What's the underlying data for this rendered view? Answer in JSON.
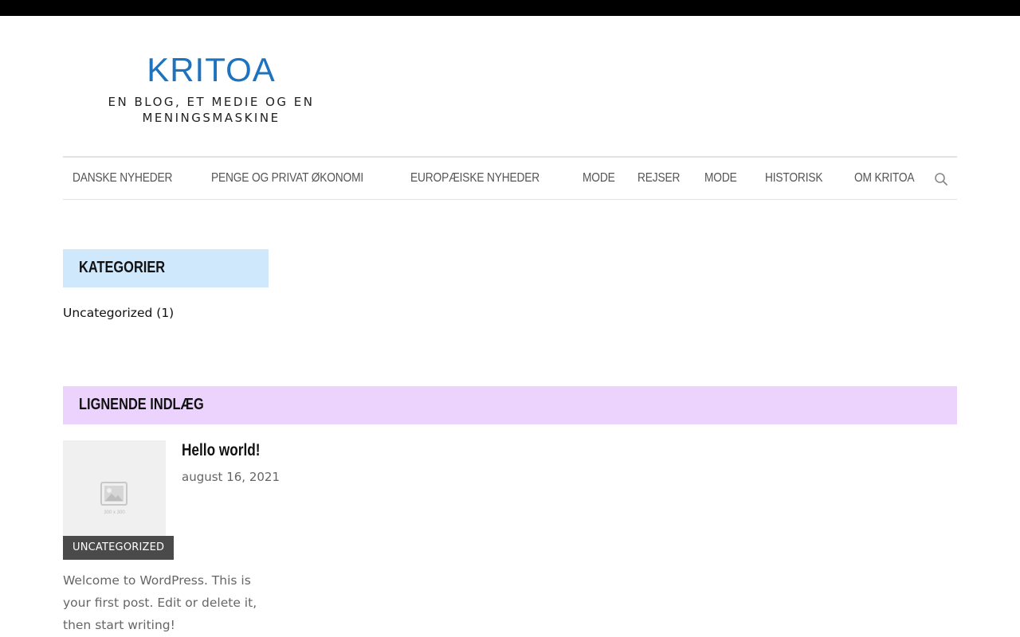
{
  "header": {
    "site_title": "KRITOA",
    "tagline": "EN BLOG, ET MEDIE OG EN MENINGSMASKINE"
  },
  "nav": {
    "items": [
      "DANSKE NYHEDER",
      "PENGE OG PRIVAT ØKONOMI",
      "EUROPÆISKE NYHEDER",
      "MODE",
      "REJSER",
      "MODE",
      "HISTORISK",
      "OM KRITOA"
    ],
    "search_icon": "search-icon"
  },
  "sidebar": {
    "categories_title": "KATEGORIER",
    "category_link": "Uncategorized",
    "category_count": "(1)"
  },
  "related": {
    "title": "LIGNENDE INDLÆG",
    "post": {
      "thumbnail_label": "300 x 300",
      "category": "UNCATEGORIZED",
      "title": "Hello world!",
      "date": "august 16, 2021",
      "excerpt": "Welcome to WordPress. This is your first post. Edit or delete it, then start writing!"
    }
  },
  "colors": {
    "title_blue": "#1e73be",
    "categories_bg": "#cfe8fb",
    "related_bg": "#ecd3fd",
    "badge_bg": "#4a4a4a"
  }
}
